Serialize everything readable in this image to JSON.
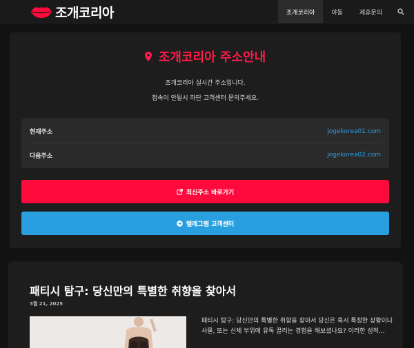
{
  "brand": {
    "name": "조개코리아",
    "accent": "#ff0a3c",
    "link_color": "#2a9fe0"
  },
  "nav": {
    "items": [
      {
        "label": "조개코리아",
        "active": true
      },
      {
        "label": "야동",
        "active": false
      },
      {
        "label": "제휴문의",
        "active": false
      }
    ],
    "search_icon": "search-icon"
  },
  "address_card": {
    "title": "조개코리아 주소안내",
    "title_icon": "map-pin-icon",
    "desc_line1": "조개코리아 실시간 주소입니다.",
    "desc_line2": "접속이 안될시 하단 고객센터 문의주세요.",
    "rows": [
      {
        "label": "현재주소",
        "value": "jogekorea01.com"
      },
      {
        "label": "다음주소",
        "value": "jogekorea02.com"
      }
    ],
    "primary_button": {
      "label": "최신주소 바로가기",
      "icon": "external-link-icon"
    },
    "secondary_button": {
      "label": "텔레그램 고객센터",
      "icon": "arrow-circle-right-icon"
    }
  },
  "article": {
    "title": "패티시 탐구: 당신만의 특별한 취향을 찾아서",
    "date": "3월 21, 2025",
    "excerpt": "패티시 탐구: 당신만의 특별한 취향을 찾아서 당신은 혹시 특정한 상황이나 사물, 또는 신체 부위에 유독 끌리는 경험을 해보셨나요? 이러한 성적..."
  }
}
